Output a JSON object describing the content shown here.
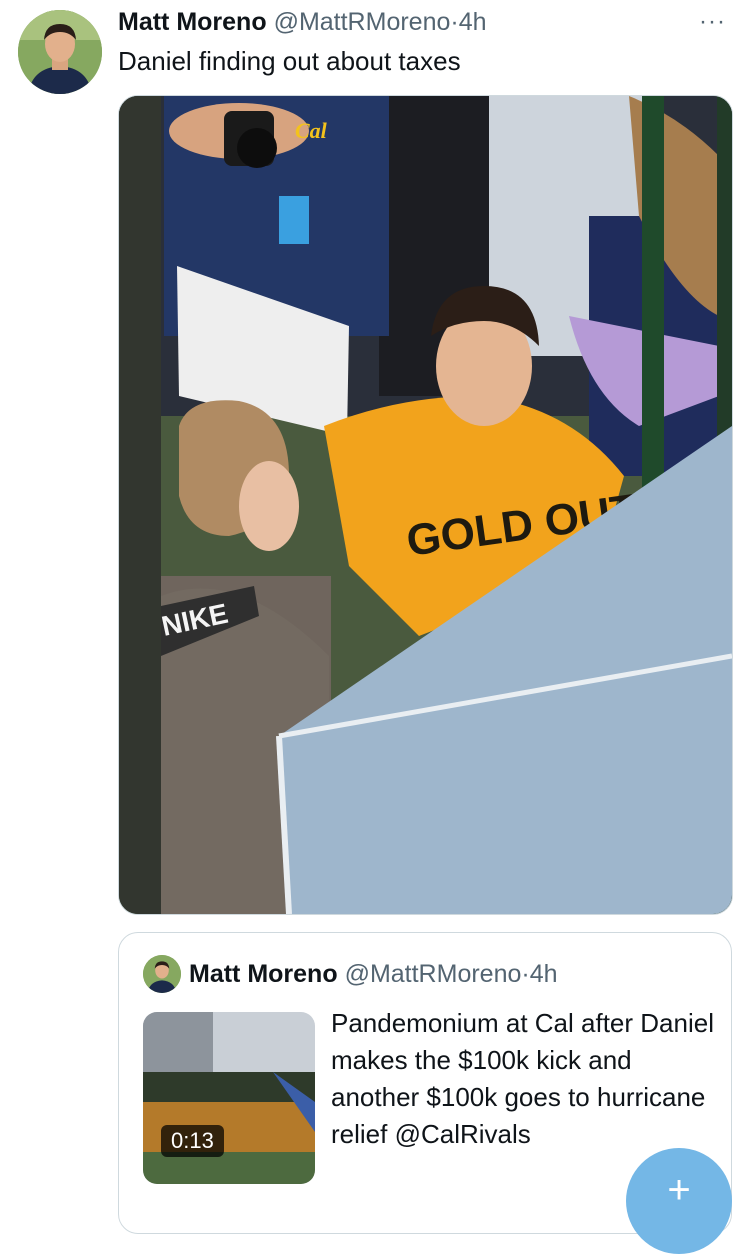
{
  "tweet": {
    "author_name": "Matt Moreno",
    "handle": "@MattRMoreno",
    "separator": "·",
    "time": "4h",
    "more_icon": "more-horizontal-icon",
    "more_glyph": "···",
    "text": "Daniel finding out about taxes",
    "photo_lettering": [
      "Cal",
      "NIKE",
      "GOLD OUT"
    ]
  },
  "quoted_tweet": {
    "author_name": "Matt Moreno",
    "handle": "@MattRMoreno",
    "separator": "·",
    "time": "4h",
    "video_duration": "0:13",
    "text": "Pandemonium at Cal after Daniel makes the $100k kick and another $100k goes to hurricane relief @CalRivals"
  },
  "compose_button": {
    "icon": "plus-icon",
    "glyph": "+",
    "color": "#74b7e6"
  },
  "colors": {
    "text": "#0f1419",
    "secondary": "#536471",
    "border": "#cfd9de"
  }
}
